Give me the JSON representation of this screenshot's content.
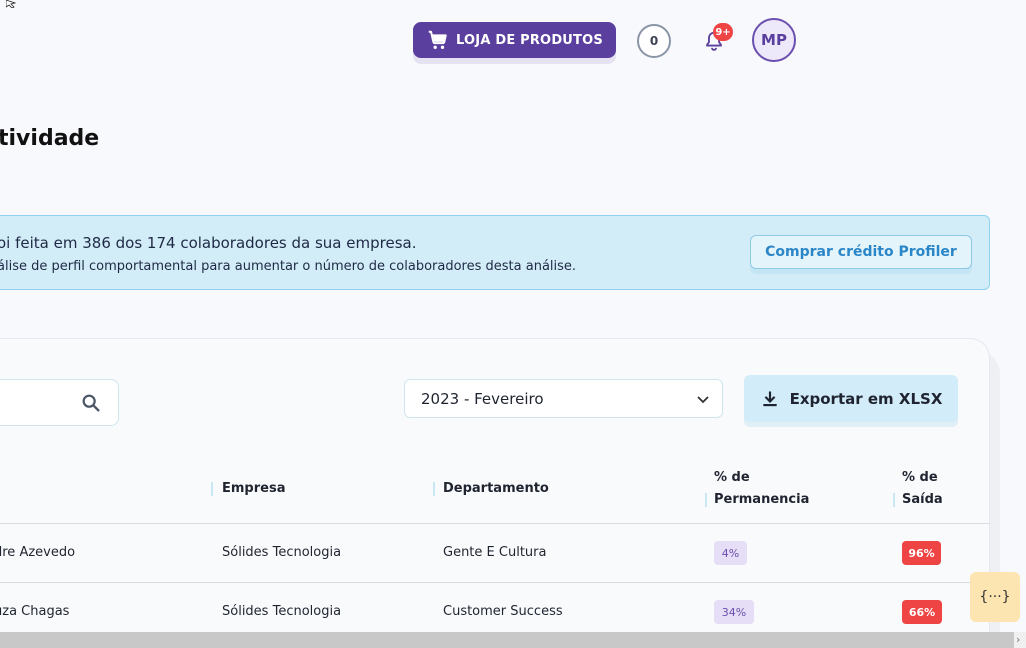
{
  "header": {
    "shop_label": "LOJA DE PRODUTOS",
    "counter": "0",
    "notifications_badge": "9+",
    "avatar_initials": "MP"
  },
  "page": {
    "title": "tividade"
  },
  "banner": {
    "line1": "oi feita em 386 dos 174 colaboradores da sua empresa.",
    "line2": "álise de perfil comportamental para aumentar o número de colaboradores desta análise.",
    "button_label": "Comprar crédito Profiler"
  },
  "filters": {
    "search_placeholder": "",
    "month_selected": "2023 - Fevereiro",
    "export_label": "Exportar em XLSX"
  },
  "table": {
    "headers": {
      "empresa": "Empresa",
      "departamento": "Departamento",
      "permanencia_l1": "% de",
      "permanencia_l2": "Permanencia",
      "saida_l1": "% de",
      "saida_l2": "Saída"
    },
    "rows": [
      {
        "nome": "dre Azevedo",
        "empresa": "Sólides Tecnologia",
        "departamento": "Gente E Cultura",
        "permanencia": "4%",
        "saida": "96%"
      },
      {
        "nome": "uza Chagas",
        "empresa": "Sólides Tecnologia",
        "departamento": "Customer Success",
        "permanencia": "34%",
        "saida": "66%"
      }
    ]
  },
  "dev_tools_label": "{···}",
  "colors": {
    "brand_purple": "#5b3f9f",
    "info_blue": "#d3edf8",
    "danger_red": "#ef4444"
  }
}
